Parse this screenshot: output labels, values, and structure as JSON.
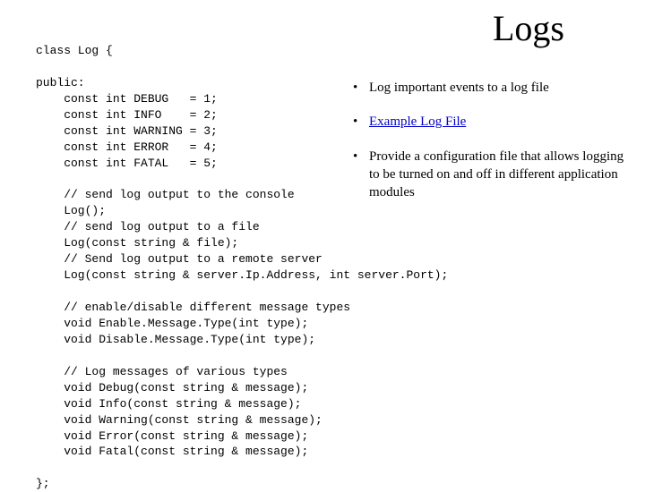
{
  "title": "Logs",
  "code": "class Log {\n\npublic:\n    const int DEBUG   = 1;\n    const int INFO    = 2;\n    const int WARNING = 3;\n    const int ERROR   = 4;\n    const int FATAL   = 5;\n\n    // send log output to the console\n    Log();\n    // send log output to a file\n    Log(const string & file);\n    // Send log output to a remote server\n    Log(const string & server.Ip.Address, int server.Port);\n\n    // enable/disable different message types\n    void Enable.Message.Type(int type);\n    void Disable.Message.Type(int type);\n\n    // Log messages of various types\n    void Debug(const string & message);\n    void Info(const string & message);\n    void Warning(const string & message);\n    void Error(const string & message);\n    void Fatal(const string & message);\n\n};",
  "bullets": {
    "b1": "Log important events to a log file",
    "b2": "Example Log File",
    "b3": "Provide a configuration file that allows logging to be turned on and off in different application modules"
  }
}
